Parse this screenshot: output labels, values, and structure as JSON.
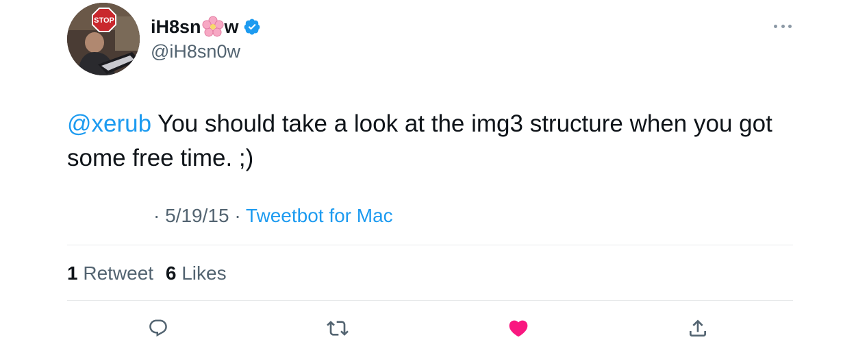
{
  "author": {
    "display_name_prefix": "iH8sn",
    "display_name_suffix": "w",
    "name_emoji": "cherry-blossom-icon",
    "verified": true,
    "handle": "@iH8sn0w",
    "avatar_sign_text": "STOP"
  },
  "tweet": {
    "mention": "@xerub",
    "text": " You should take a look at the img3 structure when you got some free time. ;)"
  },
  "meta": {
    "separator": "·",
    "date": "5/19/15",
    "source": "Tweetbot for Mac"
  },
  "stats": {
    "retweets_count": "1",
    "retweets_label": "Retweet",
    "likes_count": "6",
    "likes_label": "Likes"
  },
  "actions": {
    "reply_icon": "reply-icon",
    "retweet_icon": "retweet-icon",
    "like_icon": "heart-icon",
    "share_icon": "share-icon"
  },
  "colors": {
    "link": "#1d9bf0",
    "like_active": "#f91880",
    "secondary_text": "#536471",
    "verified": "#1d9bf0"
  }
}
